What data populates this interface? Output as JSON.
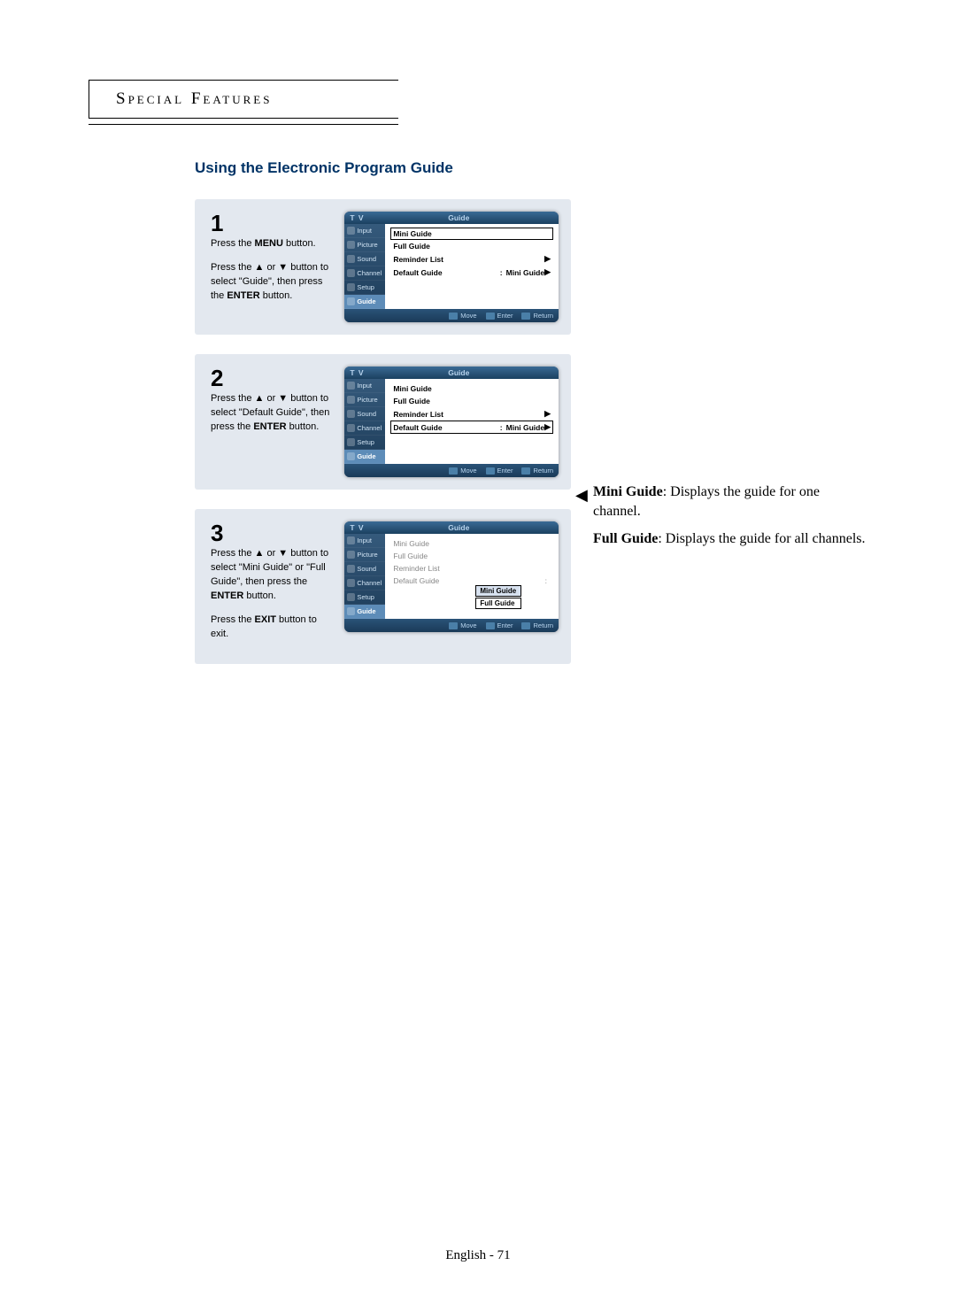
{
  "header": {
    "label": "Special Features"
  },
  "title": "Using the Electronic Program Guide",
  "steps": [
    {
      "num": "1",
      "paragraphs": [
        {
          "segments": [
            "Press the ",
            "MENU",
            " button."
          ]
        },
        {
          "segments": [
            "Press the ▲ or ▼ button to select \"Guide\", then press the ",
            "ENTER",
            " button."
          ]
        }
      ],
      "osd": {
        "tv": "T V",
        "title": "Guide",
        "sidebar": [
          "Input",
          "Picture",
          "Sound",
          "Channel",
          "Setup",
          "Guide"
        ],
        "selectedSidebar": 5,
        "rows": [
          {
            "label": "Mini Guide",
            "sel": true
          },
          {
            "label": "Full Guide"
          },
          {
            "label": "Reminder List",
            "arrow": "▶"
          },
          {
            "label": "Default Guide",
            "colon": ":",
            "val": "Mini Guide",
            "arrow": "▶"
          }
        ],
        "footer": [
          "Move",
          "Enter",
          "Return"
        ]
      }
    },
    {
      "num": "2",
      "paragraphs": [
        {
          "segments": [
            "Press the ▲ or ▼ button to select \"Default Guide\", then press the ",
            "ENTER",
            " button."
          ]
        }
      ],
      "osd": {
        "tv": "T V",
        "title": "Guide",
        "sidebar": [
          "Input",
          "Picture",
          "Sound",
          "Channel",
          "Setup",
          "Guide"
        ],
        "selectedSidebar": 5,
        "rows": [
          {
            "label": "Mini Guide"
          },
          {
            "label": "Full Guide"
          },
          {
            "label": "Reminder List",
            "arrow": "▶"
          },
          {
            "label": "Default Guide",
            "colon": ":",
            "val": "Mini Guide",
            "arrow": "▶",
            "sel": true
          }
        ],
        "footer": [
          "Move",
          "Enter",
          "Return"
        ]
      }
    },
    {
      "num": "3",
      "paragraphs": [
        {
          "segments": [
            "Press the ▲ or ▼ button to select \"Mini Guide\" or \"Full Guide\", then press the ",
            "ENTER",
            " button."
          ]
        },
        {
          "segments": [
            "Press the ",
            "EXIT",
            " button to exit."
          ]
        }
      ],
      "osd": {
        "tv": "T V",
        "title": "Guide",
        "sidebar": [
          "Input",
          "Picture",
          "Sound",
          "Channel",
          "Setup",
          "Guide"
        ],
        "selectedSidebar": 5,
        "rows": [
          {
            "label": "Mini Guide",
            "dim": true
          },
          {
            "label": "Full Guide",
            "dim": true
          },
          {
            "label": "Reminder List",
            "dim": true
          },
          {
            "label": "Default Guide",
            "colon": ":",
            "dim": true
          }
        ],
        "submenu": [
          {
            "label": "Mini Guide",
            "hl": true
          },
          {
            "label": "Full Guide"
          }
        ],
        "footer": [
          "Move",
          "Enter",
          "Return"
        ]
      }
    }
  ],
  "aside": {
    "arrow": "◀",
    "items": [
      {
        "title": "Mini Guide",
        "text": ": Displays the guide for one channel."
      },
      {
        "title": "Full Guide",
        "text": ": Displays the guide for all channels."
      }
    ]
  },
  "footer": "English - 71"
}
